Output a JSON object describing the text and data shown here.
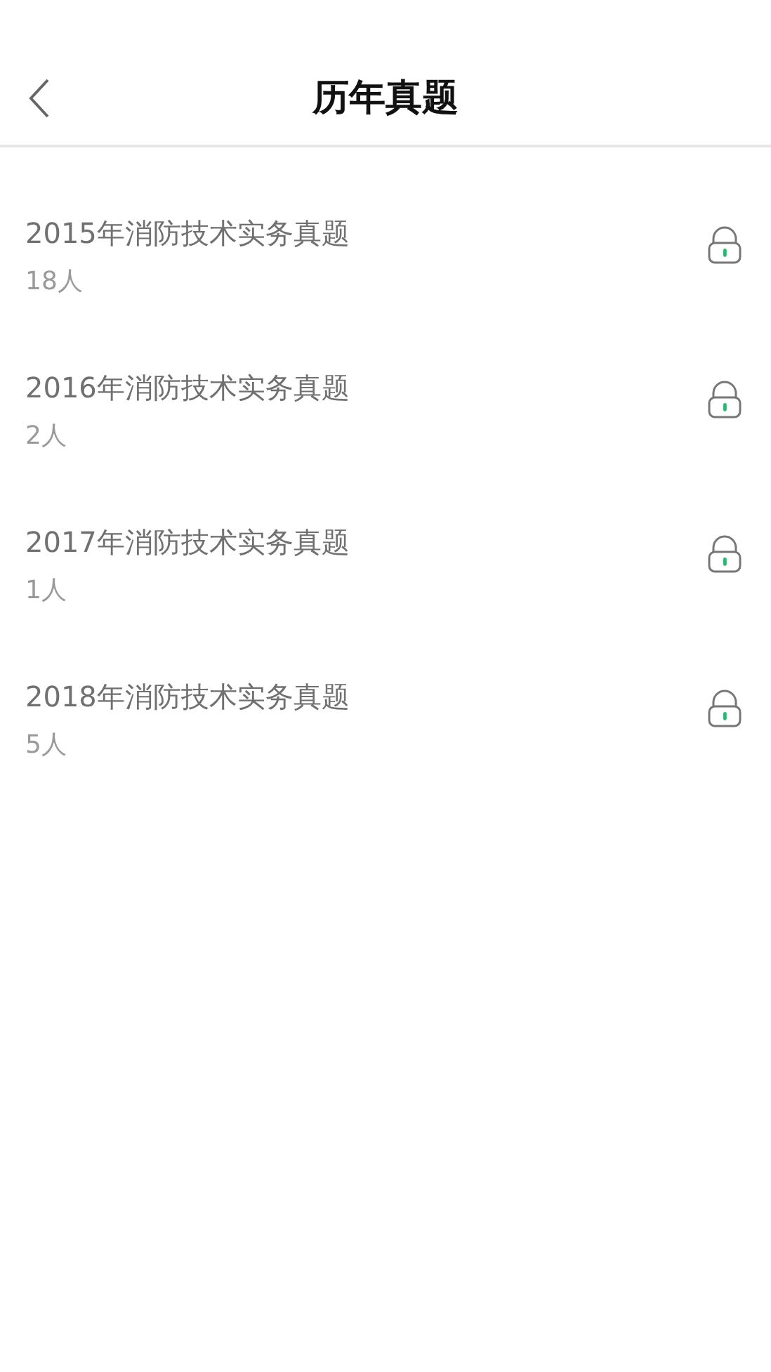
{
  "header": {
    "title": "历年真题"
  },
  "papers": [
    {
      "title": "2015年消防技术实务真题",
      "count": "18人"
    },
    {
      "title": "2016年消防技术实务真题",
      "count": "2人"
    },
    {
      "title": "2017年消防技术实务真题",
      "count": "1人"
    },
    {
      "title": "2018年消防技术实务真题",
      "count": "5人"
    }
  ]
}
